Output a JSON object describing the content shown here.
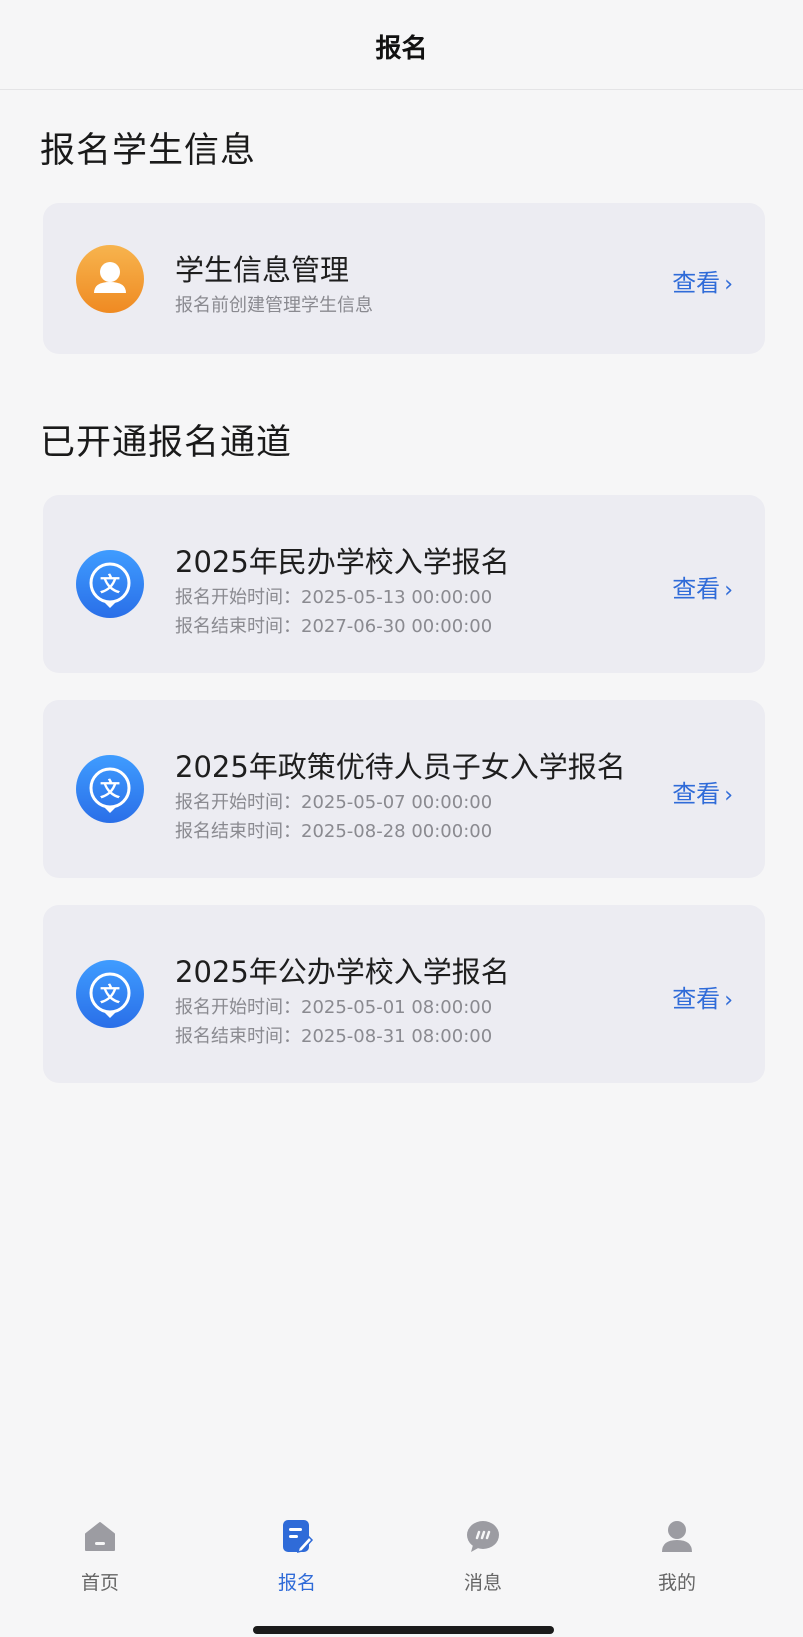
{
  "header": {
    "title": "报名"
  },
  "student_section": {
    "title": "报名学生信息",
    "card": {
      "title": "学生信息管理",
      "subtitle": "报名前创建管理学生信息",
      "action": "查看"
    }
  },
  "channels_section": {
    "title": "已开通报名通道",
    "items": [
      {
        "title": "2025年民办学校入学报名",
        "start": "报名开始时间：2025-05-13 00:00:00",
        "end": "报名结束时间：2027-06-30 00:00:00",
        "action": "查看"
      },
      {
        "title": "2025年政策优待人员子女入学报名",
        "start": "报名开始时间：2025-05-07 00:00:00",
        "end": "报名结束时间：2025-08-28 00:00:00",
        "action": "查看"
      },
      {
        "title": "2025年公办学校入学报名",
        "start": "报名开始时间：2025-05-01 08:00:00",
        "end": "报名结束时间：2025-08-31 08:00:00",
        "action": "查看"
      }
    ]
  },
  "chevron": "›",
  "channel_icon_glyph": "文",
  "tabbar": {
    "active_color": "#2f6bd8",
    "tabs": [
      {
        "label": "首页",
        "icon": "home-icon",
        "active": false
      },
      {
        "label": "报名",
        "icon": "form-edit-icon",
        "active": true
      },
      {
        "label": "消息",
        "icon": "chat-bubble-icon",
        "active": false
      },
      {
        "label": "我的",
        "icon": "user-icon",
        "active": false
      }
    ]
  }
}
